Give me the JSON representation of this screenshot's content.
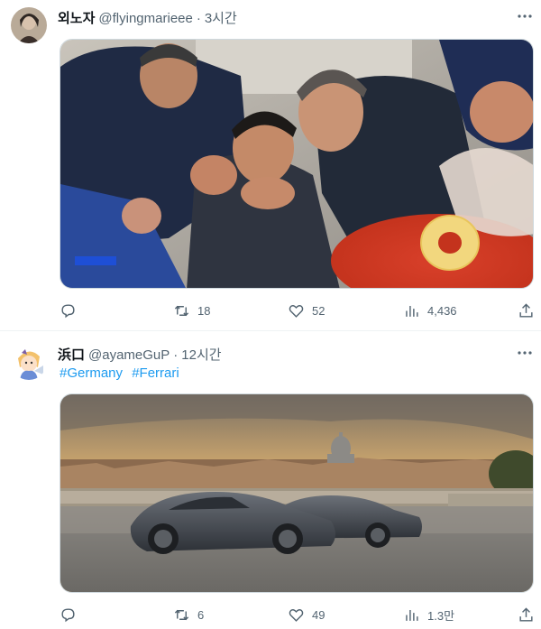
{
  "tweets": [
    {
      "name": "외노자",
      "handle": "@flyingmarieee",
      "dot": "·",
      "time": "3시간",
      "hashtags": [],
      "stats": {
        "replies": "",
        "retweets": "18",
        "likes": "52",
        "views": "4,436"
      }
    },
    {
      "name": "浜口",
      "handle": "@ayameGuP",
      "dot": "·",
      "time": "12시간",
      "hashtags": [
        "#Germany",
        "#Ferrari"
      ],
      "stats": {
        "replies": "",
        "retweets": "6",
        "likes": "49",
        "views": "1.3만"
      }
    }
  ],
  "icons": {
    "more": "more-icon",
    "reply": "reply-icon",
    "retweet": "retweet-icon",
    "like": "heart-icon",
    "views": "views-icon",
    "share": "share-icon"
  },
  "colors": {
    "text": "#0f1419",
    "muted": "#536471",
    "link": "#1d9bf0",
    "divider": "#eff3f4"
  }
}
